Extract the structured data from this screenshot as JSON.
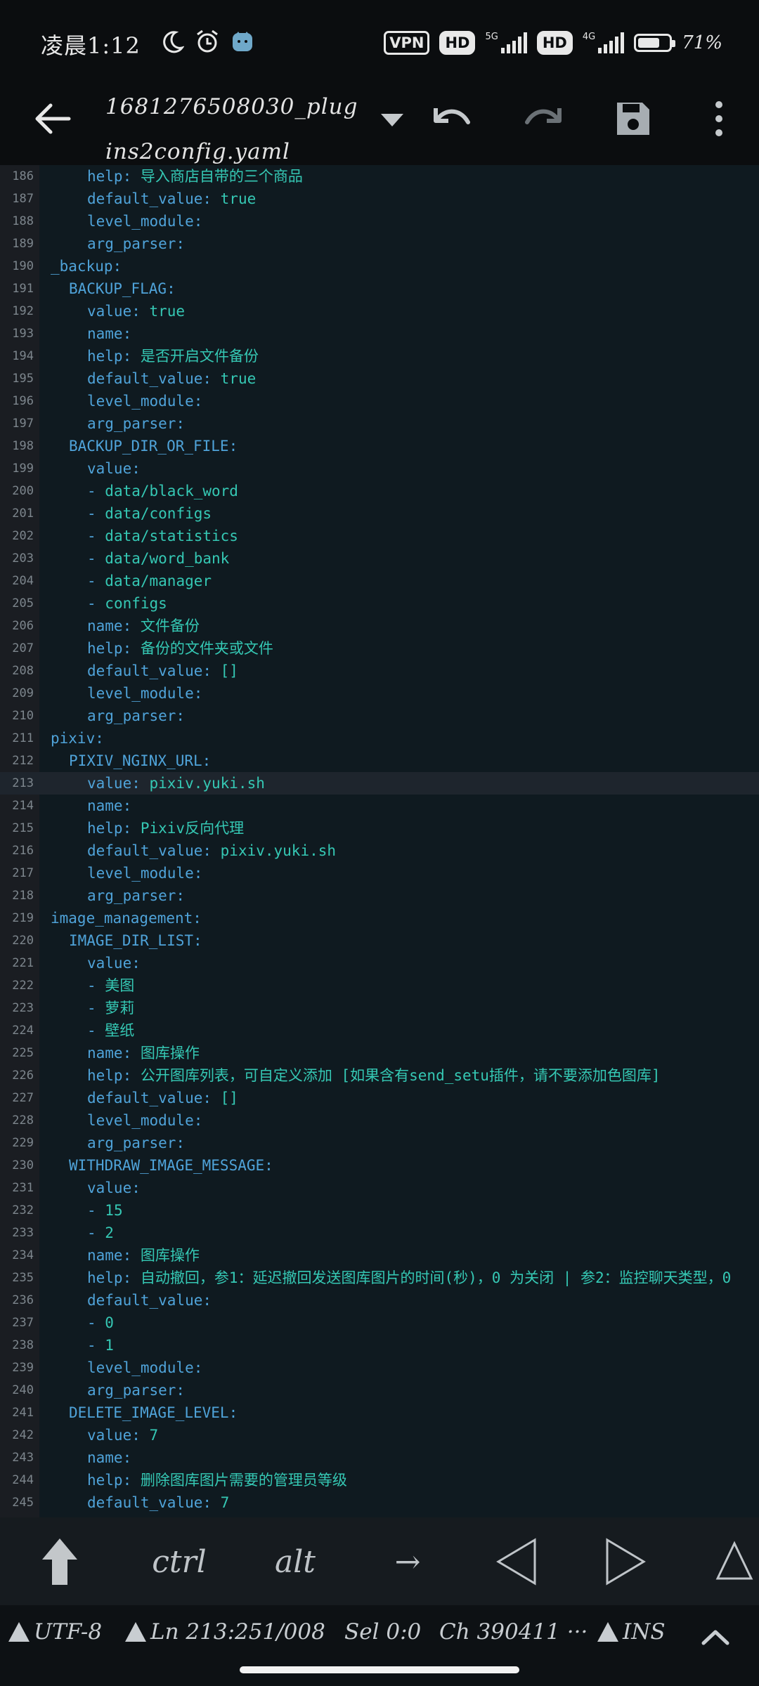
{
  "status_bar": {
    "time": "凌晨1:12",
    "vpn": "VPN",
    "hd1": "HD",
    "net1": "5G",
    "hd2": "HD",
    "net2": "4G",
    "battery_text": "71%",
    "battery_level": 0.71
  },
  "toolbar": {
    "title_line1": "1681276508030_plug",
    "title_line2": "ins2config.yaml"
  },
  "editor": {
    "active_line": 213,
    "lines": [
      {
        "n": "186",
        "indent": 4,
        "key": "help:",
        "val": " 导入商店自带的三个商品"
      },
      {
        "n": "187",
        "indent": 4,
        "key": "default_value:",
        "val": " true"
      },
      {
        "n": "188",
        "indent": 4,
        "key": "level_module:",
        "val": ""
      },
      {
        "n": "189",
        "indent": 4,
        "key": "arg_parser:",
        "val": ""
      },
      {
        "n": "190",
        "indent": 0,
        "key": "_backup:",
        "val": ""
      },
      {
        "n": "191",
        "indent": 2,
        "key": "BACKUP_FLAG:",
        "val": ""
      },
      {
        "n": "192",
        "indent": 4,
        "key": "value:",
        "val": " true"
      },
      {
        "n": "193",
        "indent": 4,
        "key": "name:",
        "val": ""
      },
      {
        "n": "194",
        "indent": 4,
        "key": "help:",
        "val": " 是否开启文件备份"
      },
      {
        "n": "195",
        "indent": 4,
        "key": "default_value:",
        "val": " true"
      },
      {
        "n": "196",
        "indent": 4,
        "key": "level_module:",
        "val": ""
      },
      {
        "n": "197",
        "indent": 4,
        "key": "arg_parser:",
        "val": ""
      },
      {
        "n": "198",
        "indent": 2,
        "key": "BACKUP_DIR_OR_FILE:",
        "val": ""
      },
      {
        "n": "199",
        "indent": 4,
        "key": "value:",
        "val": ""
      },
      {
        "n": "200",
        "indent": 4,
        "key": "- ",
        "val": "data/black_word"
      },
      {
        "n": "201",
        "indent": 4,
        "key": "- ",
        "val": "data/configs"
      },
      {
        "n": "202",
        "indent": 4,
        "key": "- ",
        "val": "data/statistics"
      },
      {
        "n": "203",
        "indent": 4,
        "key": "- ",
        "val": "data/word_bank"
      },
      {
        "n": "204",
        "indent": 4,
        "key": "- ",
        "val": "data/manager"
      },
      {
        "n": "205",
        "indent": 4,
        "key": "- ",
        "val": "configs"
      },
      {
        "n": "206",
        "indent": 4,
        "key": "name:",
        "val": " 文件备份"
      },
      {
        "n": "207",
        "indent": 4,
        "key": "help:",
        "val": " 备份的文件夹或文件"
      },
      {
        "n": "208",
        "indent": 4,
        "key": "default_value:",
        "val": " []"
      },
      {
        "n": "209",
        "indent": 4,
        "key": "level_module:",
        "val": ""
      },
      {
        "n": "210",
        "indent": 4,
        "key": "arg_parser:",
        "val": ""
      },
      {
        "n": "211",
        "indent": 0,
        "key": "pixiv:",
        "val": ""
      },
      {
        "n": "212",
        "indent": 2,
        "key": "PIXIV_NGINX_URL:",
        "val": ""
      },
      {
        "n": "213",
        "indent": 4,
        "key": "value:",
        "val": " pixiv.yuki.sh"
      },
      {
        "n": "214",
        "indent": 4,
        "key": "name:",
        "val": ""
      },
      {
        "n": "215",
        "indent": 4,
        "key": "help:",
        "val": " Pixiv反向代理"
      },
      {
        "n": "216",
        "indent": 4,
        "key": "default_value:",
        "val": " pixiv.yuki.sh"
      },
      {
        "n": "217",
        "indent": 4,
        "key": "level_module:",
        "val": ""
      },
      {
        "n": "218",
        "indent": 4,
        "key": "arg_parser:",
        "val": ""
      },
      {
        "n": "219",
        "indent": 0,
        "key": "image_management:",
        "val": ""
      },
      {
        "n": "220",
        "indent": 2,
        "key": "IMAGE_DIR_LIST:",
        "val": ""
      },
      {
        "n": "221",
        "indent": 4,
        "key": "value:",
        "val": ""
      },
      {
        "n": "222",
        "indent": 4,
        "key": "- ",
        "val": "美图"
      },
      {
        "n": "223",
        "indent": 4,
        "key": "- ",
        "val": "萝莉"
      },
      {
        "n": "224",
        "indent": 4,
        "key": "- ",
        "val": "壁纸"
      },
      {
        "n": "225",
        "indent": 4,
        "key": "name:",
        "val": " 图库操作"
      },
      {
        "n": "226",
        "indent": 4,
        "key": "help:",
        "val": " 公开图库列表，可自定义添加 [如果含有send_setu插件，请不要添加色图库]"
      },
      {
        "n": "227",
        "indent": 4,
        "key": "default_value:",
        "val": " []"
      },
      {
        "n": "228",
        "indent": 4,
        "key": "level_module:",
        "val": ""
      },
      {
        "n": "229",
        "indent": 4,
        "key": "arg_parser:",
        "val": ""
      },
      {
        "n": "230",
        "indent": 2,
        "key": "WITHDRAW_IMAGE_MESSAGE:",
        "val": ""
      },
      {
        "n": "231",
        "indent": 4,
        "key": "value:",
        "val": ""
      },
      {
        "n": "232",
        "indent": 4,
        "key": "- ",
        "val": "15"
      },
      {
        "n": "233",
        "indent": 4,
        "key": "- ",
        "val": "2"
      },
      {
        "n": "234",
        "indent": 4,
        "key": "name:",
        "val": " 图库操作"
      },
      {
        "n": "235",
        "indent": 4,
        "key": "help:",
        "val": " 自动撤回，参1：延迟撤回发送图库图片的时间(秒)，0 为关闭 | 参2：监控聊天类型，0"
      },
      {
        "n": "236",
        "indent": 4,
        "key": "default_value:",
        "val": ""
      },
      {
        "n": "237",
        "indent": 4,
        "key": "- ",
        "val": "0"
      },
      {
        "n": "238",
        "indent": 4,
        "key": "- ",
        "val": "1"
      },
      {
        "n": "239",
        "indent": 4,
        "key": "level_module:",
        "val": ""
      },
      {
        "n": "240",
        "indent": 4,
        "key": "arg_parser:",
        "val": ""
      },
      {
        "n": "241",
        "indent": 2,
        "key": "DELETE_IMAGE_LEVEL:",
        "val": ""
      },
      {
        "n": "242",
        "indent": 4,
        "key": "value:",
        "val": " 7"
      },
      {
        "n": "243",
        "indent": 4,
        "key": "name:",
        "val": ""
      },
      {
        "n": "244",
        "indent": 4,
        "key": "help:",
        "val": " 删除图库图片需要的管理员等级"
      },
      {
        "n": "245",
        "indent": 4,
        "key": "default_value:",
        "val": " 7"
      }
    ]
  },
  "extra_keys": {
    "ctrl": "ctrl",
    "alt": "alt",
    "tab": "→"
  },
  "status_line": {
    "encoding": "UTF-8",
    "position": "Ln 213:251/008",
    "selection": "Sel 0:0",
    "chars": "Ch 390411 ···",
    "mode": "INS"
  }
}
